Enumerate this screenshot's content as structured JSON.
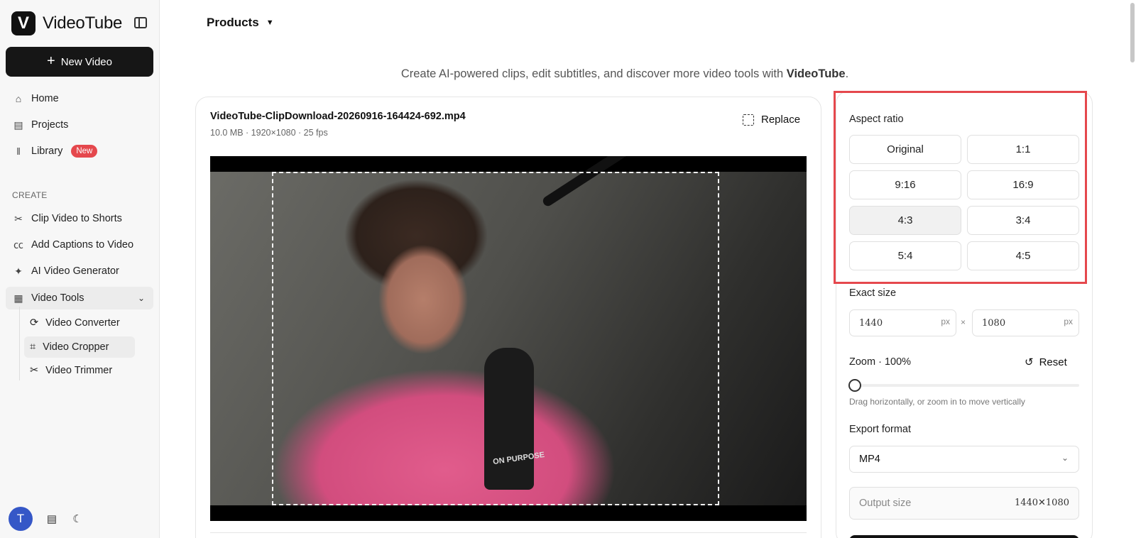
{
  "brand": {
    "logo_letter": "V",
    "name": "VideoTube"
  },
  "sidebar": {
    "new_video": "New Video",
    "main_items": [
      {
        "label": "Home",
        "icon": "home-icon"
      },
      {
        "label": "Projects",
        "icon": "projects-icon"
      },
      {
        "label": "Library",
        "icon": "library-icon",
        "badge": "New"
      }
    ],
    "section": "CREATE",
    "create_items": [
      {
        "label": "Clip Video to Shorts",
        "icon": "scissors-icon"
      },
      {
        "label": "Add Captions to Video",
        "icon": "captions-icon"
      },
      {
        "label": "AI Video Generator",
        "icon": "magic-wand-icon"
      },
      {
        "label": "Video Tools",
        "icon": "video-tools-icon"
      }
    ],
    "tool_items": [
      {
        "label": "Video Converter",
        "icon": "refresh-icon"
      },
      {
        "label": "Video Cropper",
        "icon": "crop-icon",
        "selected": true
      },
      {
        "label": "Video Trimmer",
        "icon": "scissors-icon"
      }
    ],
    "avatar_letter": "T"
  },
  "header": {
    "products": "Products"
  },
  "tagline": {
    "prefix": "Create AI-powered clips, edit subtitles, and discover more video tools with ",
    "brand": "VideoTube",
    "suffix": "."
  },
  "file": {
    "name": "VideoTube-ClipDownload-20260916-164424-692.mp4",
    "meta": "10.0 MB · 1920×1080 · 25 fps",
    "replace": "Replace"
  },
  "video": {
    "mic_label": "ON PURPOSE"
  },
  "settings": {
    "aspect_ratio_label": "Aspect ratio",
    "ratios": [
      "Original",
      "1:1",
      "9:16",
      "16:9",
      "4:3",
      "3:4",
      "5:4",
      "4:5"
    ],
    "selected_ratio": "4:3",
    "exact_size_label": "Exact size",
    "width": "1440",
    "height": "1080",
    "unit": "px",
    "times": "×",
    "zoom_label": "Zoom · 100%",
    "reset": "Reset",
    "zoom_hint": "Drag horizontally, or zoom in to move vertically",
    "export_format_label": "Export format",
    "export_format": "MP4",
    "output_size_label": "Output size",
    "output_size": "1440✕1080"
  },
  "colors": {
    "accent": "#e5484d",
    "primary_dark": "#161616",
    "avatar": "#3557c7"
  }
}
